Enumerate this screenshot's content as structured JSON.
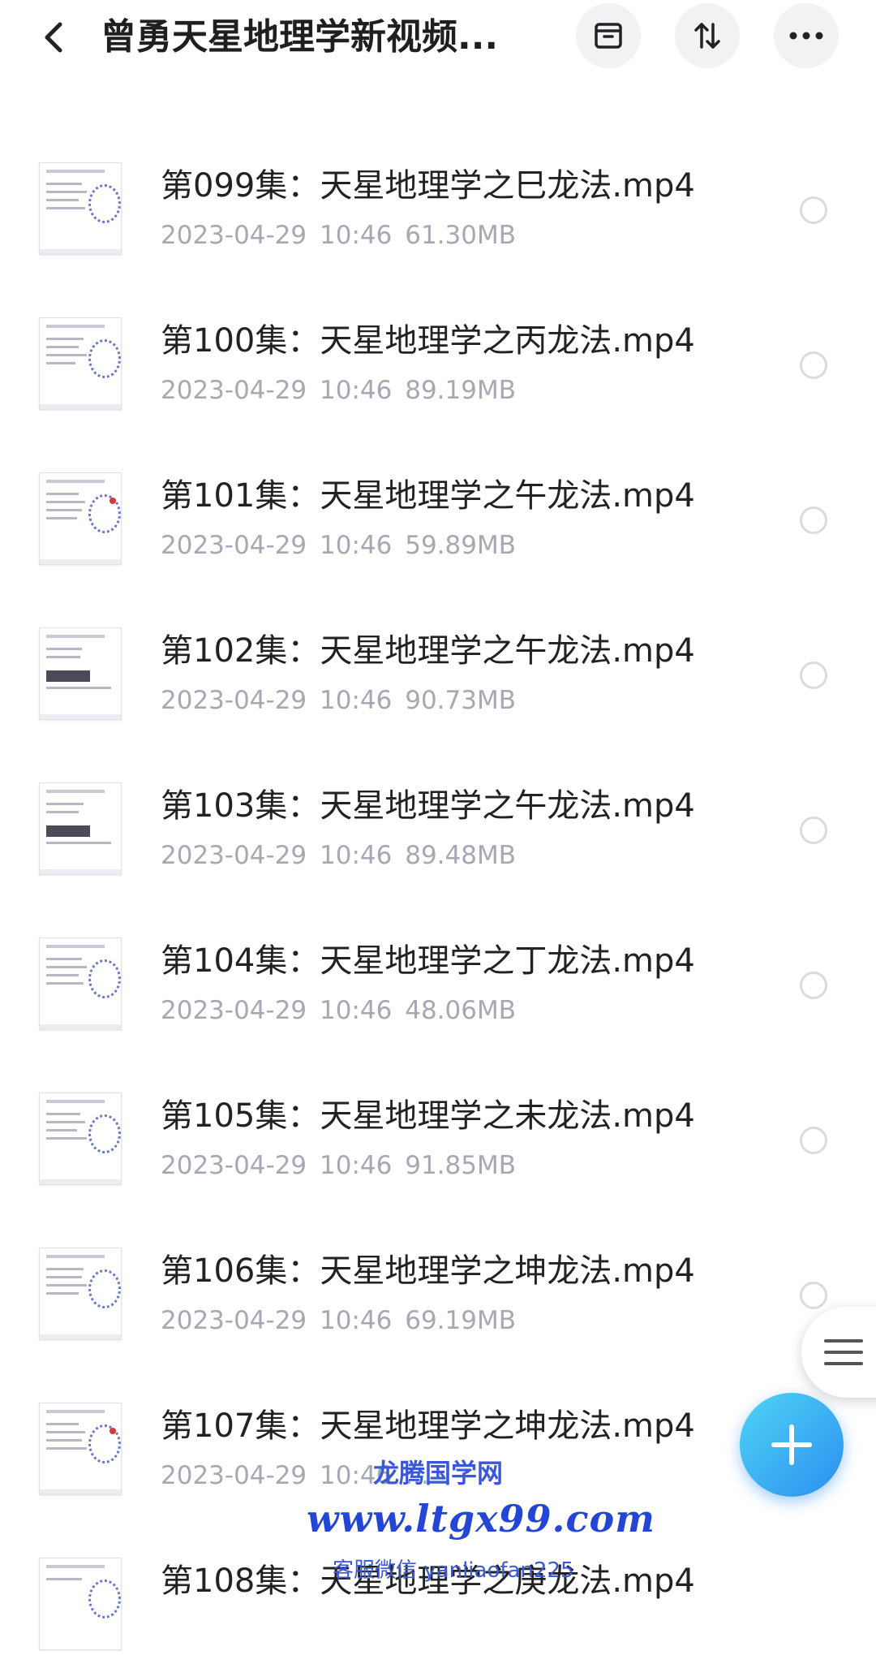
{
  "header": {
    "title": "曾勇天星地理学新视频..."
  },
  "files": [
    {
      "name": "第099集：天星地理学之巳龙法.mp4",
      "date": "2023-04-29",
      "time": "10:46",
      "size": "61.30MB"
    },
    {
      "name": "第100集：天星地理学之丙龙法.mp4",
      "date": "2023-04-29",
      "time": "10:46",
      "size": "89.19MB"
    },
    {
      "name": "第101集：天星地理学之午龙法.mp4",
      "date": "2023-04-29",
      "time": "10:46",
      "size": "59.89MB"
    },
    {
      "name": "第102集：天星地理学之午龙法.mp4",
      "date": "2023-04-29",
      "time": "10:46",
      "size": "90.73MB"
    },
    {
      "name": "第103集：天星地理学之午龙法.mp4",
      "date": "2023-04-29",
      "time": "10:46",
      "size": "89.48MB"
    },
    {
      "name": "第104集：天星地理学之丁龙法.mp4",
      "date": "2023-04-29",
      "time": "10:46",
      "size": "48.06MB"
    },
    {
      "name": "第105集：天星地理学之未龙法.mp4",
      "date": "2023-04-29",
      "time": "10:46",
      "size": "91.85MB"
    },
    {
      "name": "第106集：天星地理学之坤龙法.mp4",
      "date": "2023-04-29",
      "time": "10:46",
      "size": "69.19MB"
    },
    {
      "name": "第107集：天星地理学之坤龙法.mp4",
      "date": "2023-04-29",
      "time": "10:46",
      "size": "..."
    },
    {
      "name": "第108集：天星地理学之庚龙法.mp4",
      "date": "",
      "time": "",
      "size": ""
    }
  ],
  "watermark": {
    "name": "龙腾国学网",
    "url": "www.ltgx99.com",
    "contact": "客服微信 yanliaofan225"
  },
  "colors": {
    "accent": "#2b8ff0",
    "meta_text": "#a6a9b3",
    "watermark": "#2446d6"
  }
}
